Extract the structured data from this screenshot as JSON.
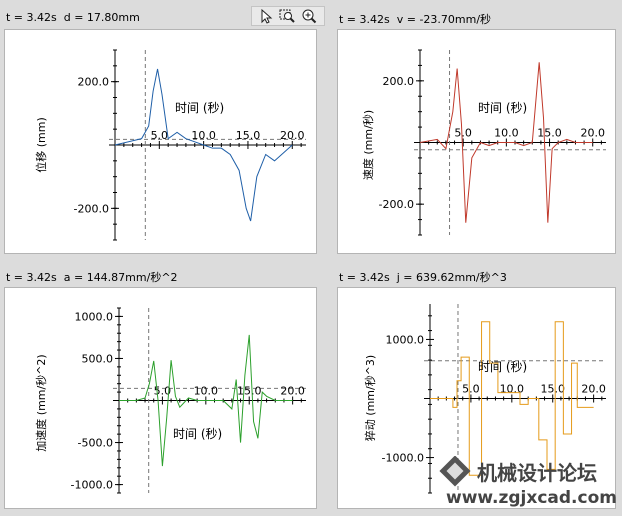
{
  "toolbar": {
    "icons": [
      "pointer-icon",
      "zoom-region-icon",
      "zoom-in-icon"
    ]
  },
  "watermark": {
    "cn": "机械设计论坛",
    "url": "www.zgjxcad.com"
  },
  "chart_data": [
    {
      "id": "pos",
      "type": "line",
      "header": "t = 3.42s  d = 17.80mm",
      "xlabel": "时间 (秒)",
      "ylabel": "位移 (mm)",
      "color": "#1f5fa8",
      "xlim": [
        0,
        22
      ],
      "ylim": [
        -300,
        300
      ],
      "xticks": [
        5,
        10,
        15,
        20
      ],
      "xtick_labels": [
        "5.0",
        "10.0",
        "15.0",
        "20.0"
      ],
      "yticks": [
        200,
        -200
      ],
      "ytick_labels": [
        "200.0",
        "-200.0"
      ],
      "cursor_t": 3.42,
      "cursor_value": 17.8,
      "x": [
        0,
        3,
        3.8,
        4.3,
        4.8,
        5.3,
        6,
        7,
        8,
        9,
        10,
        11,
        12,
        13,
        14,
        14.8,
        15.3,
        16,
        17,
        18,
        20
      ],
      "y": [
        0,
        20,
        60,
        170,
        240,
        160,
        20,
        40,
        20,
        10,
        0,
        -10,
        -10,
        -30,
        -80,
        -200,
        -240,
        -100,
        -30,
        -50,
        0
      ]
    },
    {
      "id": "vel",
      "type": "line",
      "header": "t = 3.42s  v = -23.70mm/秒",
      "xlabel": "时间 (秒)",
      "ylabel": "速度 (mm/秒)",
      "color": "#c0392b",
      "xlim": [
        0,
        22
      ],
      "ylim": [
        -300,
        300
      ],
      "xticks": [
        5,
        10,
        15,
        20
      ],
      "xtick_labels": [
        "5.0",
        "10.0",
        "15.0",
        "20.0"
      ],
      "yticks": [
        200,
        -200
      ],
      "ytick_labels": [
        "200.0",
        "-200.0"
      ],
      "cursor_t": 3.42,
      "cursor_value": -23.7,
      "x": [
        0,
        2,
        3,
        3.8,
        4.3,
        4.8,
        5.3,
        6,
        7,
        8,
        9,
        10,
        11,
        12,
        13,
        13.8,
        14.3,
        14.8,
        15.3,
        16,
        17,
        18,
        19,
        20
      ],
      "y": [
        0,
        10,
        -20,
        100,
        240,
        60,
        -260,
        -50,
        0,
        -10,
        0,
        0,
        0,
        -10,
        0,
        260,
        80,
        -260,
        -20,
        0,
        10,
        0,
        0,
        0
      ]
    },
    {
      "id": "acc",
      "type": "line",
      "header": "t = 3.42s  a = 144.87mm/秒^2",
      "xlabel": "时间 (秒)",
      "ylabel": "加速度 (mm/秒^2)",
      "color": "#2ca02c",
      "xlim": [
        0,
        22
      ],
      "ylim": [
        -1100,
        1100
      ],
      "xticks": [
        5,
        10,
        15,
        20
      ],
      "xtick_labels": [
        "5.0",
        "10.0",
        "15.0",
        "20.0"
      ],
      "yticks": [
        1000,
        500,
        -500,
        -1000
      ],
      "ytick_labels": [
        "1000.0",
        "500.0",
        "-500.0",
        "-1000.0"
      ],
      "cursor_t": 3.42,
      "cursor_value": 144.87,
      "x": [
        0,
        2,
        3,
        3.5,
        4,
        4.5,
        5,
        5.5,
        6,
        6.5,
        7,
        8,
        9,
        10,
        11,
        12,
        13,
        13.5,
        14,
        14.5,
        15,
        15.5,
        16,
        16.5,
        17,
        18,
        19,
        20
      ],
      "y": [
        0,
        0,
        30,
        200,
        470,
        0,
        -780,
        -200,
        480,
        50,
        -80,
        30,
        0,
        0,
        0,
        0,
        -100,
        250,
        -500,
        300,
        780,
        -250,
        -450,
        100,
        50,
        0,
        0,
        0
      ]
    },
    {
      "id": "jerk",
      "type": "line",
      "header": "t = 3.42s  j = 639.62mm/秒^3",
      "xlabel": "时间 (秒)",
      "ylabel": "猝动 (mm/秒^3)",
      "color": "#e59b1a",
      "xlim": [
        0,
        22
      ],
      "ylim": [
        -1600,
        1600
      ],
      "xticks": [
        5,
        10,
        15,
        20
      ],
      "xtick_labels": [
        "5.0",
        "10.0",
        "15.0",
        "20.0"
      ],
      "yticks": [
        1000,
        -1000
      ],
      "ytick_labels": [
        "1000.0",
        "-1000.0"
      ],
      "cursor_t": 3.42,
      "cursor_value": 639.62,
      "x": [
        0,
        2.8,
        2.8,
        3.3,
        3.3,
        3.8,
        3.8,
        4.8,
        4.8,
        6.3,
        6.3,
        7.3,
        7.3,
        8.3,
        8.3,
        11,
        11,
        12,
        12,
        13.3,
        13.3,
        14.3,
        14.3,
        15.3,
        15.3,
        16.3,
        16.3,
        17.3,
        17.3,
        18,
        18,
        20
      ],
      "y": [
        0,
        0,
        -150,
        -150,
        300,
        300,
        700,
        700,
        -1300,
        -1300,
        1300,
        1300,
        600,
        600,
        100,
        100,
        -100,
        -100,
        0,
        0,
        -700,
        -700,
        -1200,
        -1200,
        1300,
        1300,
        -600,
        -600,
        600,
        600,
        -150,
        -150
      ]
    }
  ]
}
